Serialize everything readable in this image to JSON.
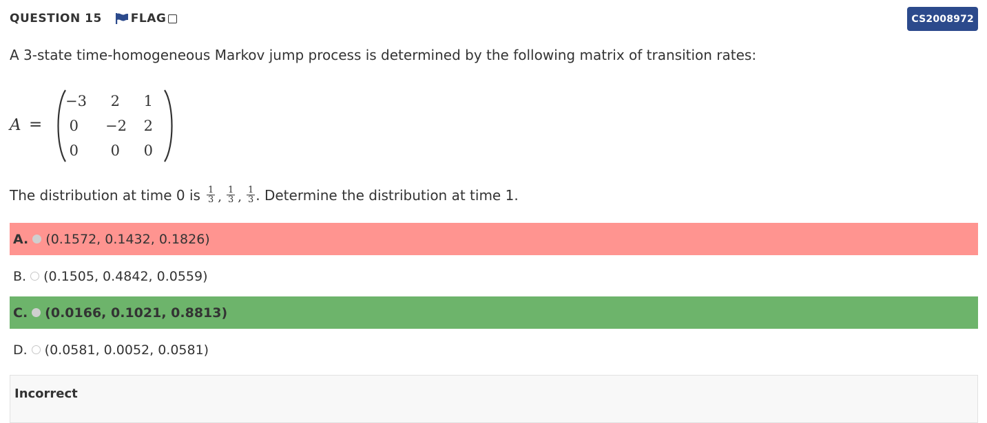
{
  "header": {
    "question_label": "QUESTION 15",
    "flag_label": "FLAG",
    "flag_icon": "flag-icon",
    "flag_checked": false,
    "flag_color": "#2c4a8c",
    "question_code": "CS2008972",
    "code_badge_color": "#2c4a8c"
  },
  "question": {
    "prompt": "A 3-state time-homogeneous Markov jump process is determined by the following matrix of transition rates:",
    "matrix": {
      "name": "A",
      "equals": "=",
      "rows": [
        [
          "−3",
          "2",
          "1"
        ],
        [
          "0",
          "−2",
          "2"
        ],
        [
          "0",
          "0",
          "0"
        ]
      ]
    },
    "distribution": {
      "prefix": "The distribution at time 0 is",
      "fractions": [
        {
          "num": "1",
          "den": "3"
        },
        {
          "num": "1",
          "den": "3"
        },
        {
          "num": "1",
          "den": "3"
        }
      ],
      "separator": ",",
      "suffix": ". Determine the distribution at time 1."
    }
  },
  "options": [
    {
      "letter": "A.",
      "text": "(0.1572, 0.1432, 0.1826)",
      "state": "incorrect-selected",
      "selected": true,
      "background": "#ff9490"
    },
    {
      "letter": "B.",
      "text": "(0.1505, 0.4842, 0.0559)",
      "state": "neutral",
      "selected": false
    },
    {
      "letter": "C.",
      "text": "(0.0166, 0.1021, 0.8813)",
      "state": "correct",
      "selected": false,
      "background": "#6db46b"
    },
    {
      "letter": "D.",
      "text": "(0.0581, 0.0052, 0.0581)",
      "state": "neutral",
      "selected": false
    }
  ],
  "feedback": {
    "text": "Incorrect"
  }
}
